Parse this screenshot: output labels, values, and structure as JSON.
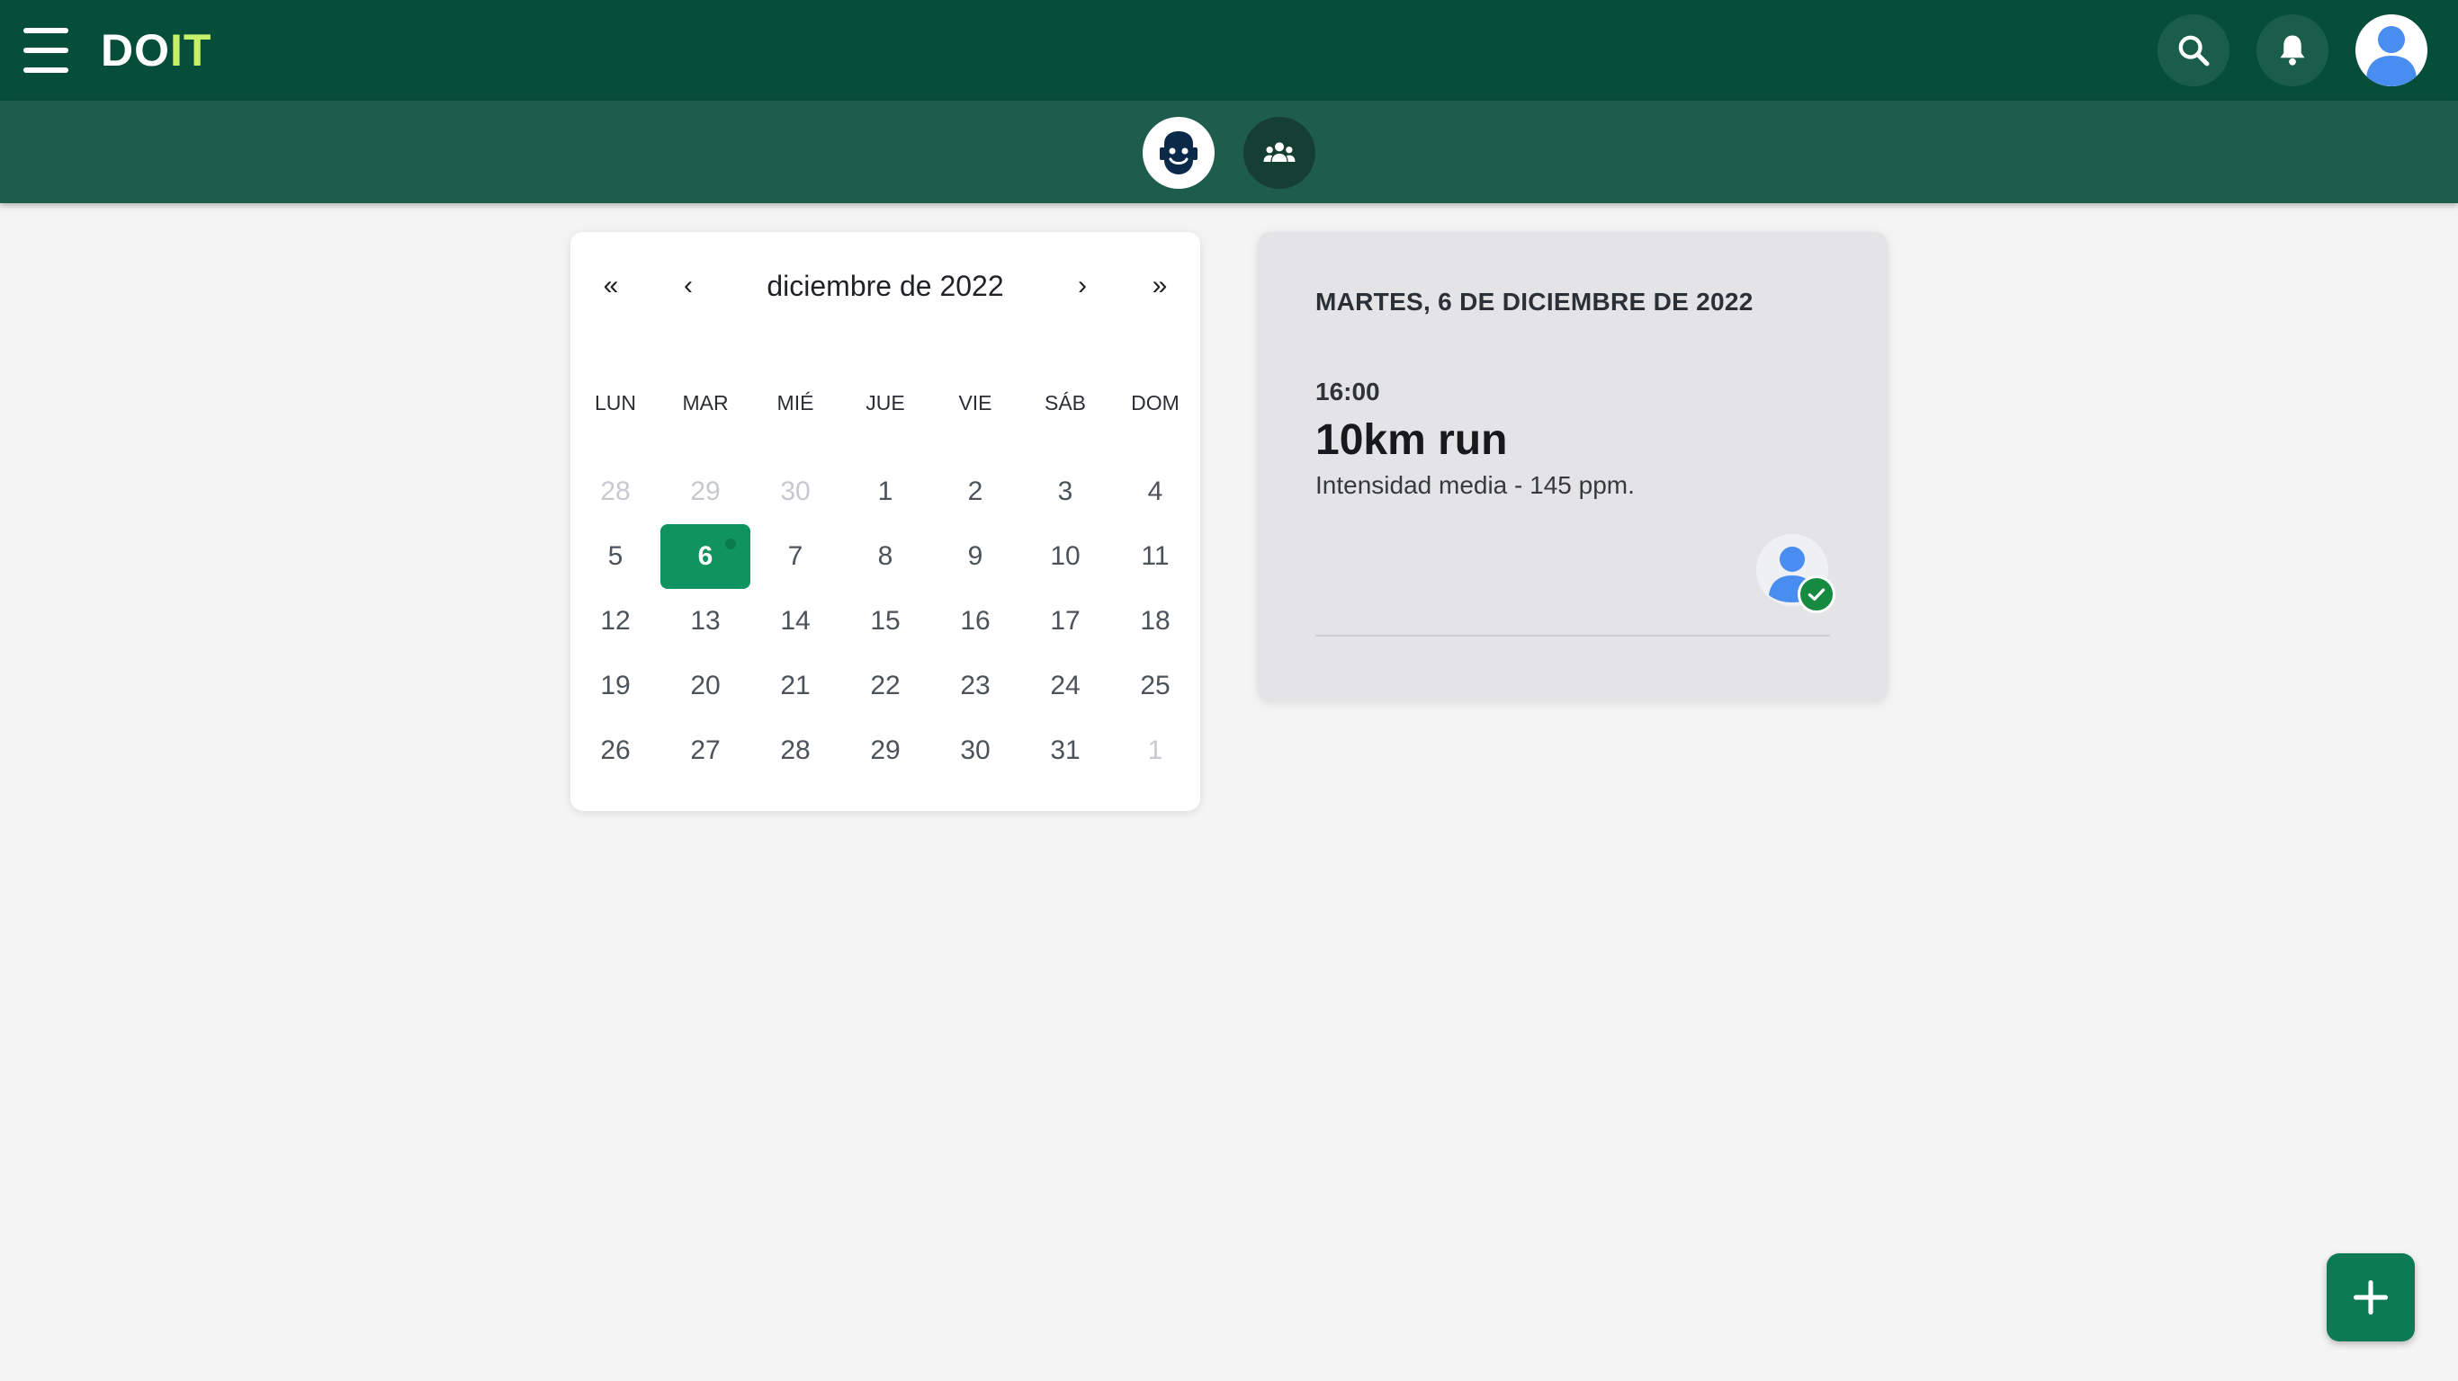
{
  "app": {
    "logo_part1": "DO",
    "logo_part2": "IT",
    "colors": {
      "topbar": "#064d3a",
      "subbar": "#1e5d4b",
      "accent": "#0f9460",
      "logo_accent": "#c6f06a"
    }
  },
  "topbar": {
    "icons": [
      "menu-icon",
      "search-icon",
      "bell-icon",
      "user-avatar-icon"
    ]
  },
  "subbar": {
    "icons": [
      "personal-face-icon",
      "group-people-icon"
    ]
  },
  "calendar": {
    "nav_prev_year": "«",
    "nav_prev_month": "‹",
    "title": "diciembre de 2022",
    "nav_next_month": "›",
    "nav_next_year": "»",
    "weekdays": [
      "LUN",
      "MAR",
      "MIÉ",
      "JUE",
      "VIE",
      "SÁB",
      "DOM"
    ],
    "weeks": [
      [
        "28",
        "29",
        "30",
        "1",
        "2",
        "3",
        "4"
      ],
      [
        "5",
        "6",
        "7",
        "8",
        "9",
        "10",
        "11"
      ],
      [
        "12",
        "13",
        "14",
        "15",
        "16",
        "17",
        "18"
      ],
      [
        "19",
        "20",
        "21",
        "22",
        "23",
        "24",
        "25"
      ],
      [
        "26",
        "27",
        "28",
        "29",
        "30",
        "31",
        "1"
      ]
    ],
    "selected_day": "6"
  },
  "agenda": {
    "date_heading": "MARTES, 6 DE DICIEMBRE DE 2022",
    "event": {
      "time": "16:00",
      "title": "10km run",
      "description": "Intensidad media - 145 ppm."
    }
  },
  "fab": {
    "label": "+"
  }
}
